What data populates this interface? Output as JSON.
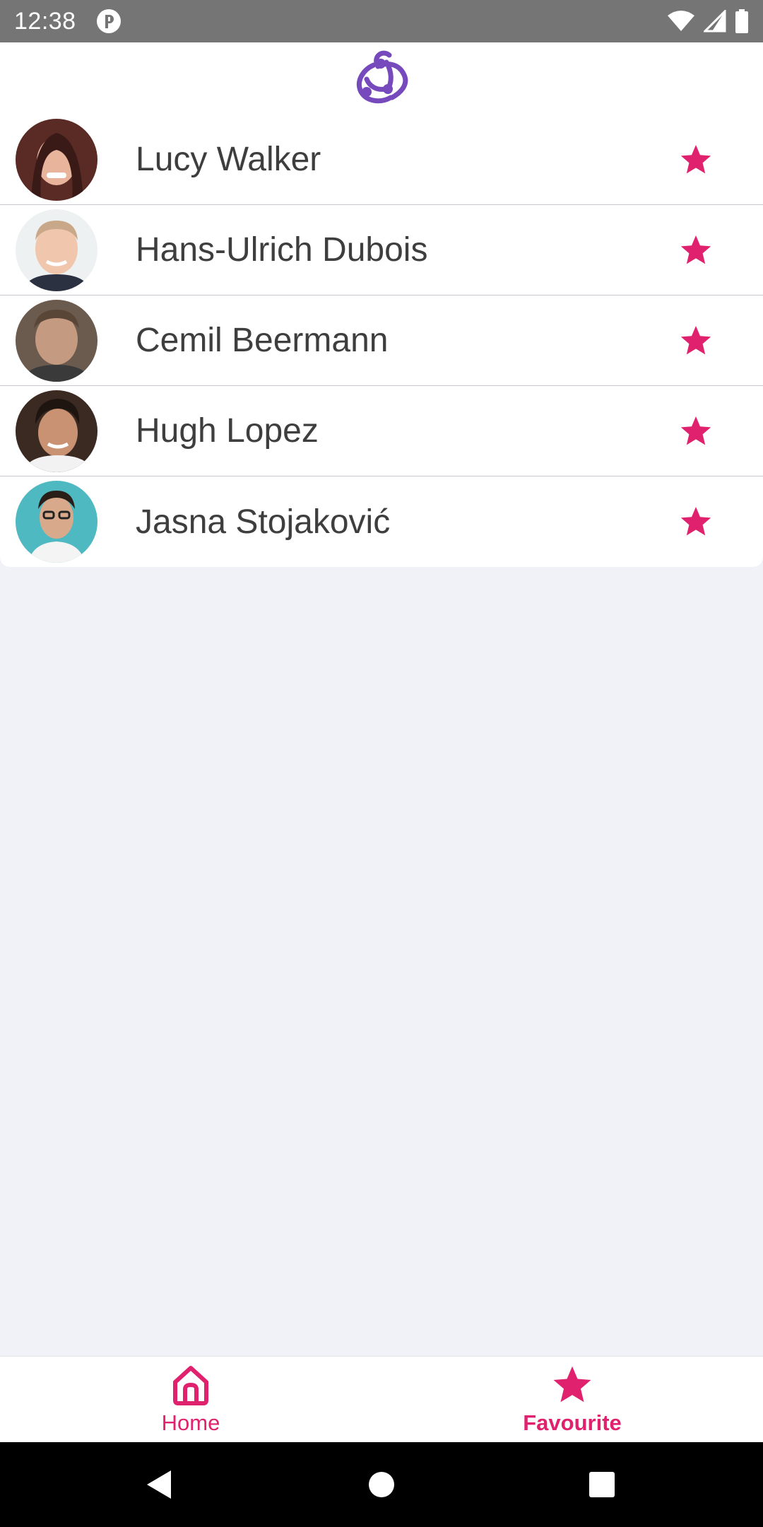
{
  "status_bar": {
    "time": "12:38",
    "icons": [
      "app-notification-icon",
      "wifi-icon",
      "cell-signal-icon",
      "battery-icon"
    ]
  },
  "header": {
    "logo_icon": "redux-logo-icon",
    "logo_color": "#764abc"
  },
  "contacts": [
    {
      "name": "Lucy Walker",
      "avatar_color": "#5a2a25",
      "favourite": true
    },
    {
      "name": "Hans-Ulrich Dubois",
      "avatar_color": "#d9c9bd",
      "favourite": true
    },
    {
      "name": "Cemil Beermann",
      "avatar_color": "#6b5a4e",
      "favourite": true
    },
    {
      "name": "Hugh Lopez",
      "avatar_color": "#3b2a22",
      "favourite": true
    },
    {
      "name": "Jasna Stojaković",
      "avatar_color": "#4fb9c2",
      "favourite": true
    }
  ],
  "bottom_nav": {
    "items": [
      {
        "label": "Home",
        "icon": "home-icon",
        "active": false
      },
      {
        "label": "Favourite",
        "icon": "star-icon",
        "active": true
      }
    ]
  },
  "colors": {
    "accent": "#e0226e",
    "background": "#f1f2f8",
    "text": "#3e3e3e"
  },
  "system_nav": {
    "buttons": [
      "back-icon",
      "home-circle-icon",
      "recents-icon"
    ]
  }
}
